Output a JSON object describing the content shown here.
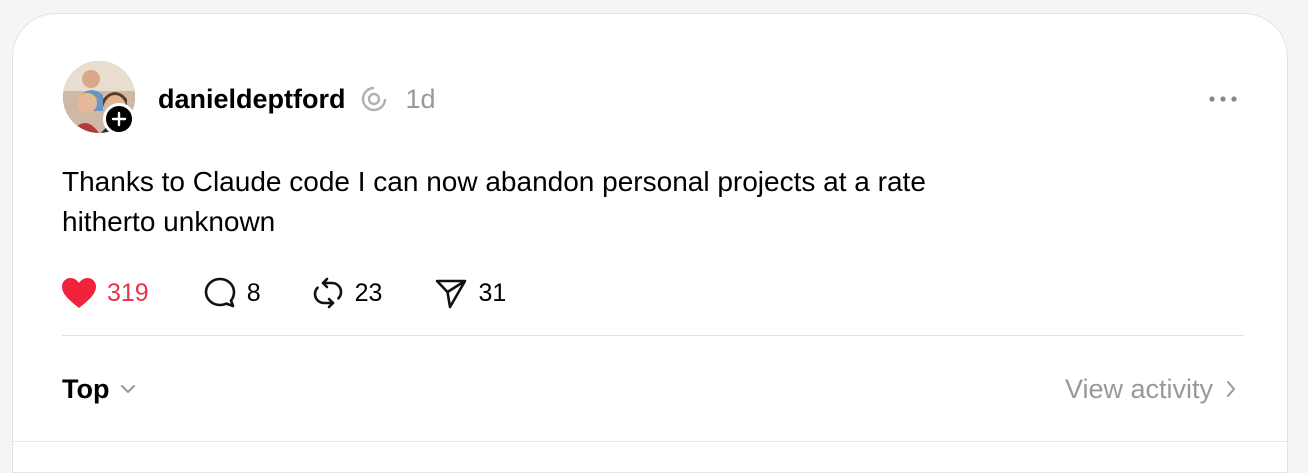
{
  "post": {
    "username": "danieldeptford",
    "verified_icon": "threads-verified-icon",
    "timestamp": "1d",
    "text_line1": "Thanks to Claude code I can now abandon personal projects at a rate",
    "text_line2": "hitherto unknown"
  },
  "actions": {
    "likes": "319",
    "replies": "8",
    "reposts": "23",
    "shares": "31"
  },
  "footer": {
    "sort_label": "Top",
    "view_activity_label": "View activity"
  },
  "colors": {
    "like": "#e8344a",
    "muted": "#999999",
    "text": "#000000"
  }
}
